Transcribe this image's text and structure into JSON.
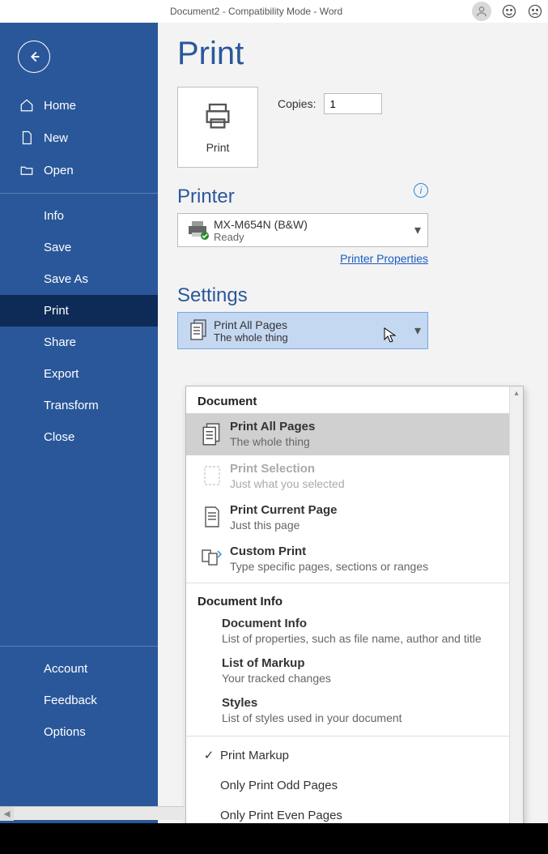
{
  "titlebar": {
    "text": "Document2  -  Compatibility Mode  -  Word"
  },
  "sidebar": {
    "items": [
      {
        "label": "Home"
      },
      {
        "label": "New"
      },
      {
        "label": "Open"
      },
      {
        "label": "Info"
      },
      {
        "label": "Save"
      },
      {
        "label": "Save As"
      },
      {
        "label": "Print"
      },
      {
        "label": "Share"
      },
      {
        "label": "Export"
      },
      {
        "label": "Transform"
      },
      {
        "label": "Close"
      },
      {
        "label": "Account"
      },
      {
        "label": "Feedback"
      },
      {
        "label": "Options"
      }
    ]
  },
  "page": {
    "title": "Print",
    "print_button": "Print",
    "copies_label": "Copies:",
    "copies_value": "1"
  },
  "printer": {
    "section": "Printer",
    "name": "MX-M654N (B&W)",
    "status": "Ready",
    "properties_link": "Printer Properties"
  },
  "settings": {
    "section": "Settings",
    "selected_title": "Print All Pages",
    "selected_sub": "The whole thing"
  },
  "dropdown": {
    "group_document": "Document",
    "items": [
      {
        "title": "Print All Pages",
        "sub": "The whole thing"
      },
      {
        "title": "Print Selection",
        "sub": "Just what you selected"
      },
      {
        "title": "Print Current Page",
        "sub": "Just this page"
      },
      {
        "title": "Custom Print",
        "sub": "Type specific pages, sections or ranges"
      }
    ],
    "group_info": "Document Info",
    "info_items": [
      {
        "title": "Document Info",
        "sub": "List of properties, such as file name, author and title"
      },
      {
        "title": "List of Markup",
        "sub": "Your tracked changes"
      },
      {
        "title": "Styles",
        "sub": "List of styles used in your document"
      }
    ],
    "check_items": [
      {
        "label": "Print Markup",
        "checked": true
      },
      {
        "label": "Only Print Odd Pages",
        "checked": false
      },
      {
        "label": "Only Print Even Pages",
        "checked": false
      }
    ]
  }
}
